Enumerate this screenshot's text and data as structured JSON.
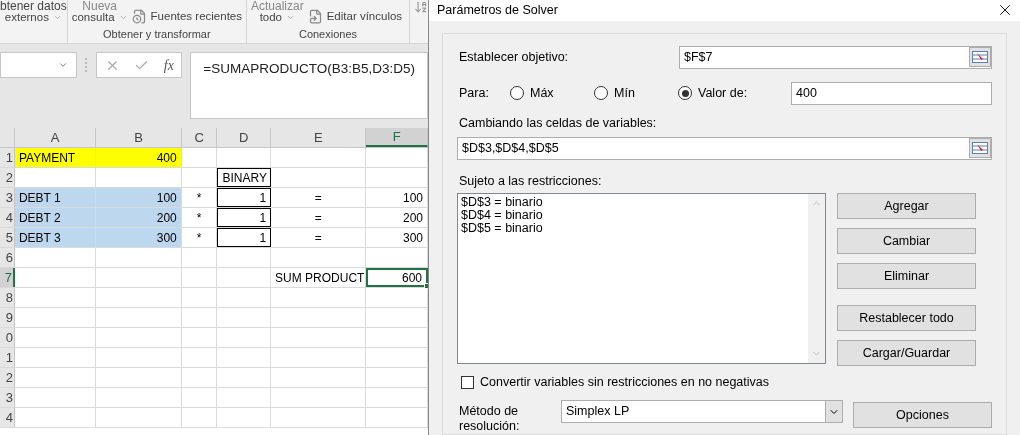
{
  "ribbon": {
    "top_labels": [
      "btener datos",
      "Nueva",
      "Actualizar"
    ],
    "commands": [
      {
        "label": "externos",
        "kind": "dropdown"
      },
      {
        "label": "consulta",
        "kind": "dropdown"
      },
      {
        "label": "Fuentes recientes",
        "kind": "icon"
      },
      {
        "label": "todo",
        "kind": "dropdown"
      },
      {
        "label": "Editar vínculos",
        "kind": "icon"
      }
    ],
    "groups": [
      "Obtener y transformar",
      "Conexiones"
    ]
  },
  "formula_bar": {
    "fx_label": "fx",
    "formula": "=SUMAPRODUCTO(B3:B5,D3:D5)"
  },
  "sheet": {
    "columns": [
      {
        "label": "A",
        "selected": false
      },
      {
        "label": "B",
        "selected": false
      },
      {
        "label": "C",
        "selected": false
      },
      {
        "label": "D",
        "selected": false
      },
      {
        "label": "E",
        "selected": false
      },
      {
        "label": "F",
        "selected": true
      }
    ],
    "rows": [
      {
        "number": "1",
        "selected": false,
        "cells": [
          {
            "text": "PAYMENT",
            "kind": "text",
            "color": "#ffff00",
            "selected": false
          },
          {
            "text": "400",
            "kind": "number",
            "color": "#ffff00",
            "selected": false
          },
          {
            "selected": false
          },
          {
            "selected": false
          },
          {
            "selected": false
          },
          {
            "selected": false
          }
        ]
      },
      {
        "number": "2",
        "selected": false,
        "cells": [
          {
            "selected": false
          },
          {
            "selected": false
          },
          {
            "selected": false
          },
          {
            "text": "BINARY",
            "kind": "text",
            "boxed": true,
            "selected": false
          },
          {
            "selected": false
          },
          {
            "selected": false
          }
        ]
      },
      {
        "number": "3",
        "selected": false,
        "cells": [
          {
            "text": "DEBT 1",
            "kind": "text",
            "color": "#bdd7ee",
            "selected": false
          },
          {
            "text": "100",
            "kind": "number",
            "color": "#bdd7ee",
            "selected": false
          },
          {
            "text": "*",
            "kind": "symbol",
            "selected": false
          },
          {
            "text": "1",
            "kind": "number",
            "boxed": true,
            "selected": false
          },
          {
            "text": "=",
            "kind": "symbol",
            "selected": false
          },
          {
            "text": "100",
            "kind": "number",
            "selected": false
          }
        ]
      },
      {
        "number": "4",
        "selected": false,
        "cells": [
          {
            "text": "DEBT 2",
            "kind": "text",
            "color": "#bdd7ee",
            "selected": false
          },
          {
            "text": "200",
            "kind": "number",
            "color": "#bdd7ee",
            "selected": false
          },
          {
            "text": "*",
            "kind": "symbol",
            "selected": false
          },
          {
            "text": "1",
            "kind": "number",
            "boxed": true,
            "selected": false
          },
          {
            "text": "=",
            "kind": "symbol",
            "selected": false
          },
          {
            "text": "200",
            "kind": "number",
            "selected": false
          }
        ]
      },
      {
        "number": "5",
        "selected": false,
        "cells": [
          {
            "text": "DEBT 3",
            "kind": "text",
            "color": "#bdd7ee",
            "selected": false
          },
          {
            "text": "300",
            "kind": "number",
            "color": "#bdd7ee",
            "selected": false
          },
          {
            "text": "*",
            "kind": "symbol",
            "selected": false
          },
          {
            "text": "1",
            "kind": "number",
            "boxed": true,
            "selected": false
          },
          {
            "text": "=",
            "kind": "symbol",
            "selected": false
          },
          {
            "text": "300",
            "kind": "number",
            "selected": false
          }
        ]
      },
      {
        "number": "6",
        "selected": false,
        "cells": [
          {
            "selected": false
          },
          {
            "selected": false
          },
          {
            "selected": false
          },
          {
            "selected": false
          },
          {
            "selected": false
          },
          {
            "selected": false
          }
        ]
      },
      {
        "number": "7",
        "selected": true,
        "cells": [
          {
            "selected": false
          },
          {
            "selected": false
          },
          {
            "selected": false
          },
          {
            "selected": false
          },
          {
            "text": "SUM PRODUCT",
            "kind": "text",
            "selected": false
          },
          {
            "text": "600",
            "kind": "number",
            "selected": true
          }
        ]
      },
      {
        "number": "8",
        "selected": false
      },
      {
        "number": "9",
        "selected": false
      },
      {
        "number": "0",
        "selected": false
      },
      {
        "number": "1",
        "selected": false
      },
      {
        "number": "2",
        "selected": false
      },
      {
        "number": "3",
        "selected": false
      },
      {
        "number": "4",
        "selected": false
      }
    ]
  },
  "dialog": {
    "title": "Parámetros de Solver",
    "objective": {
      "label": "Establecer objetivo:",
      "value": "$F$7"
    },
    "goal": {
      "label": "Para:",
      "options": [
        {
          "label": "Máx",
          "selected": false
        },
        {
          "label": "Mín",
          "selected": false
        },
        {
          "label": "Valor de:",
          "selected": true
        }
      ],
      "value": "400"
    },
    "variables": {
      "label": "Cambiando las celdas de variables:",
      "value": "$D$3,$D$4,$D$5"
    },
    "constraints": {
      "label": "Sujeto a las restricciones:",
      "items": [
        "$D$3 = binario",
        "$D$4 = binario",
        "$D$5 = binario"
      ]
    },
    "buttons": [
      "Agregar",
      "Cambiar",
      "Eliminar",
      "Restablecer todo",
      "Cargar/Guardar"
    ],
    "convert": {
      "label": "Convertir variables sin restricciones en no negativas",
      "checked": false
    },
    "method": {
      "label": "Método de resolución:",
      "value": "Simplex LP"
    },
    "options_button": "Opciones"
  }
}
